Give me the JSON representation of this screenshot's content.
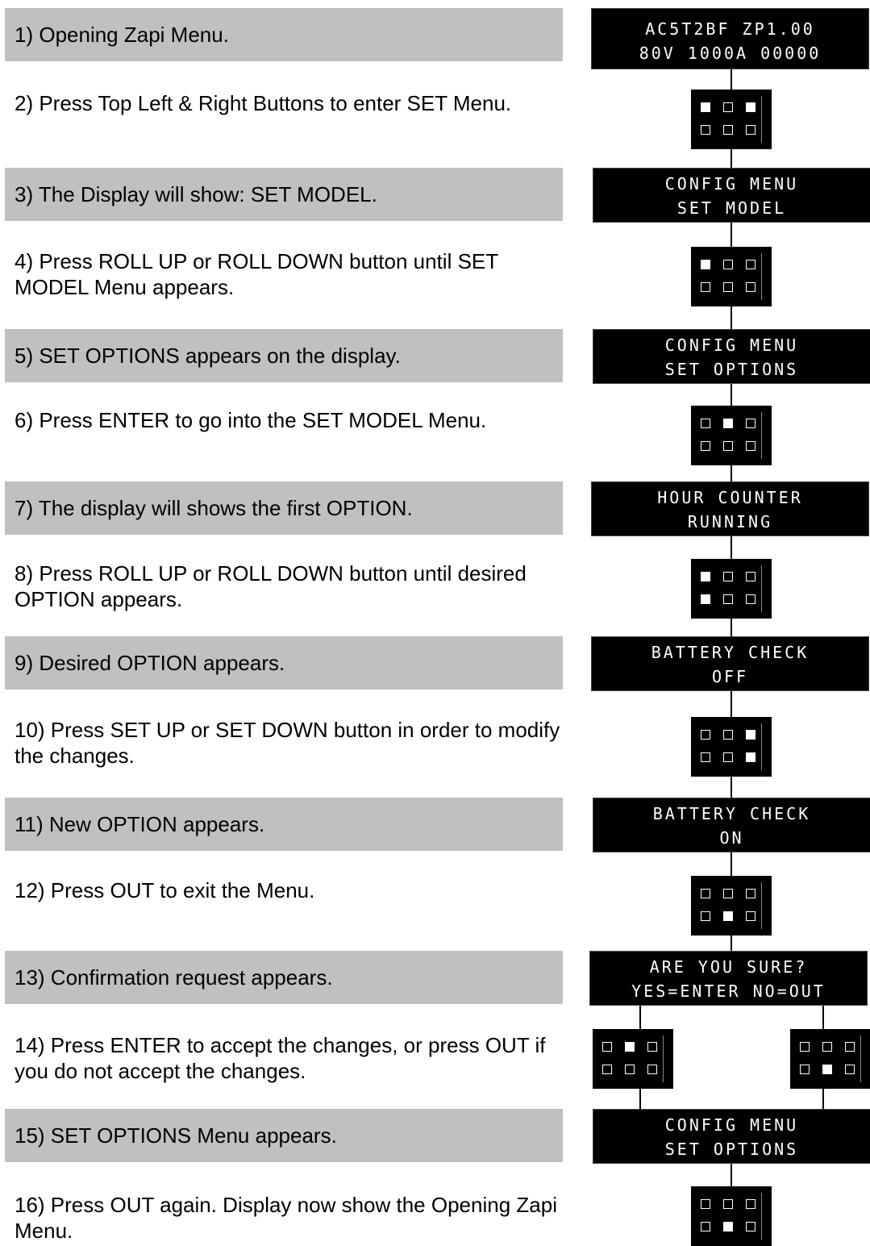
{
  "steps": [
    {
      "text": "1) Opening Zapi Menu.",
      "shaded": true
    },
    {
      "text": "2) Press Top Left & Right Buttons to enter SET Menu.",
      "shaded": false
    },
    {
      "text": "3) The Display will show: SET MODEL.",
      "shaded": true
    },
    {
      "text": "4) Press ROLL UP or ROLL DOWN button until SET MODEL Menu appears.",
      "shaded": false
    },
    {
      "text": "5) SET OPTIONS appears on the display.",
      "shaded": true
    },
    {
      "text": "6) Press ENTER to go into the SET MODEL Menu.",
      "shaded": false
    },
    {
      "text": "7) The display will shows the first OPTION.",
      "shaded": true
    },
    {
      "text": "8) Press ROLL UP or ROLL DOWN button until desired OPTION appears.",
      "shaded": false
    },
    {
      "text": "9) Desired OPTION appears.",
      "shaded": true
    },
    {
      "text": "10) Press SET UP or SET DOWN button in order to modify the changes.",
      "shaded": false
    },
    {
      "text": "11) New OPTION appears.",
      "shaded": true
    },
    {
      "text": "12) Press OUT to exit the Menu.",
      "shaded": false
    },
    {
      "text": "13) Confirmation request appears.",
      "shaded": true
    },
    {
      "text": "14) Press ENTER to accept the changes, or press OUT if you do not accept the changes.",
      "shaded": false
    },
    {
      "text": "15) SET OPTIONS Menu appears.",
      "shaded": true
    },
    {
      "text": "16) Press OUT again. Display now show the Opening Zapi Menu.",
      "shaded": false
    }
  ],
  "displays": [
    {
      "line1": "AC5T2BF    ZP1.00",
      "line2": "80V 1000A 00000"
    },
    {
      "line1": "CONFIG MENU",
      "line2": "SET MODEL"
    },
    {
      "line1": "CONFIG MENU",
      "line2": "SET OPTIONS"
    },
    {
      "line1": "HOUR COUNTER",
      "line2": "RUNNING"
    },
    {
      "line1": "BATTERY CHECK",
      "line2": "OFF"
    },
    {
      "line1": "BATTERY CHECK",
      "line2": "ON"
    },
    {
      "line1": "ARE YOU SURE?",
      "line2": "YES=ENTER NO=OUT"
    },
    {
      "line1": "CONFIG MENU",
      "line2": "SET OPTIONS"
    }
  ],
  "keypads": [
    {
      "pressed": [
        [
          1,
          0,
          1
        ],
        [
          0,
          0,
          0
        ]
      ]
    },
    {
      "pressed": [
        [
          1,
          0,
          0
        ],
        [
          0,
          0,
          0
        ]
      ]
    },
    {
      "pressed": [
        [
          0,
          1,
          0
        ],
        [
          0,
          0,
          0
        ]
      ]
    },
    {
      "pressed": [
        [
          1,
          0,
          0
        ],
        [
          1,
          0,
          0
        ]
      ]
    },
    {
      "pressed": [
        [
          0,
          0,
          1
        ],
        [
          0,
          0,
          1
        ]
      ]
    },
    {
      "pressed": [
        [
          0,
          0,
          0
        ],
        [
          0,
          1,
          0
        ]
      ]
    },
    {
      "pressed": [
        [
          0,
          1,
          0
        ],
        [
          0,
          0,
          0
        ]
      ]
    },
    {
      "pressed": [
        [
          0,
          0,
          0
        ],
        [
          0,
          1,
          0
        ]
      ]
    },
    {
      "pressed": [
        [
          0,
          0,
          0
        ],
        [
          0,
          1,
          0
        ]
      ]
    }
  ]
}
